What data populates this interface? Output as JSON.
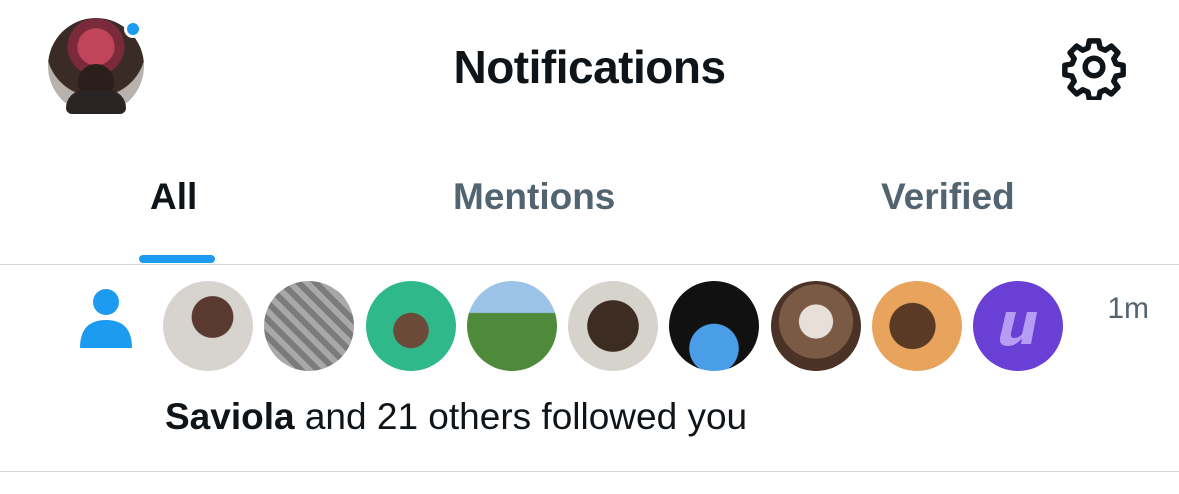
{
  "header": {
    "title": "Notifications",
    "profile_avatar_icon": "user-avatar",
    "settings_icon": "gear-icon",
    "unread_dot_color": "#1d9bf0"
  },
  "tabs": [
    {
      "label": "All",
      "active": true
    },
    {
      "label": "Mentions",
      "active": false
    },
    {
      "label": "Verified",
      "active": false
    }
  ],
  "notification": {
    "type_icon": "person-icon",
    "timestamp": "1m",
    "actor": "Saviola",
    "rest_text": "and 21 others followed you",
    "avatar_count": 9,
    "accent_color": "#1d9bf0"
  }
}
